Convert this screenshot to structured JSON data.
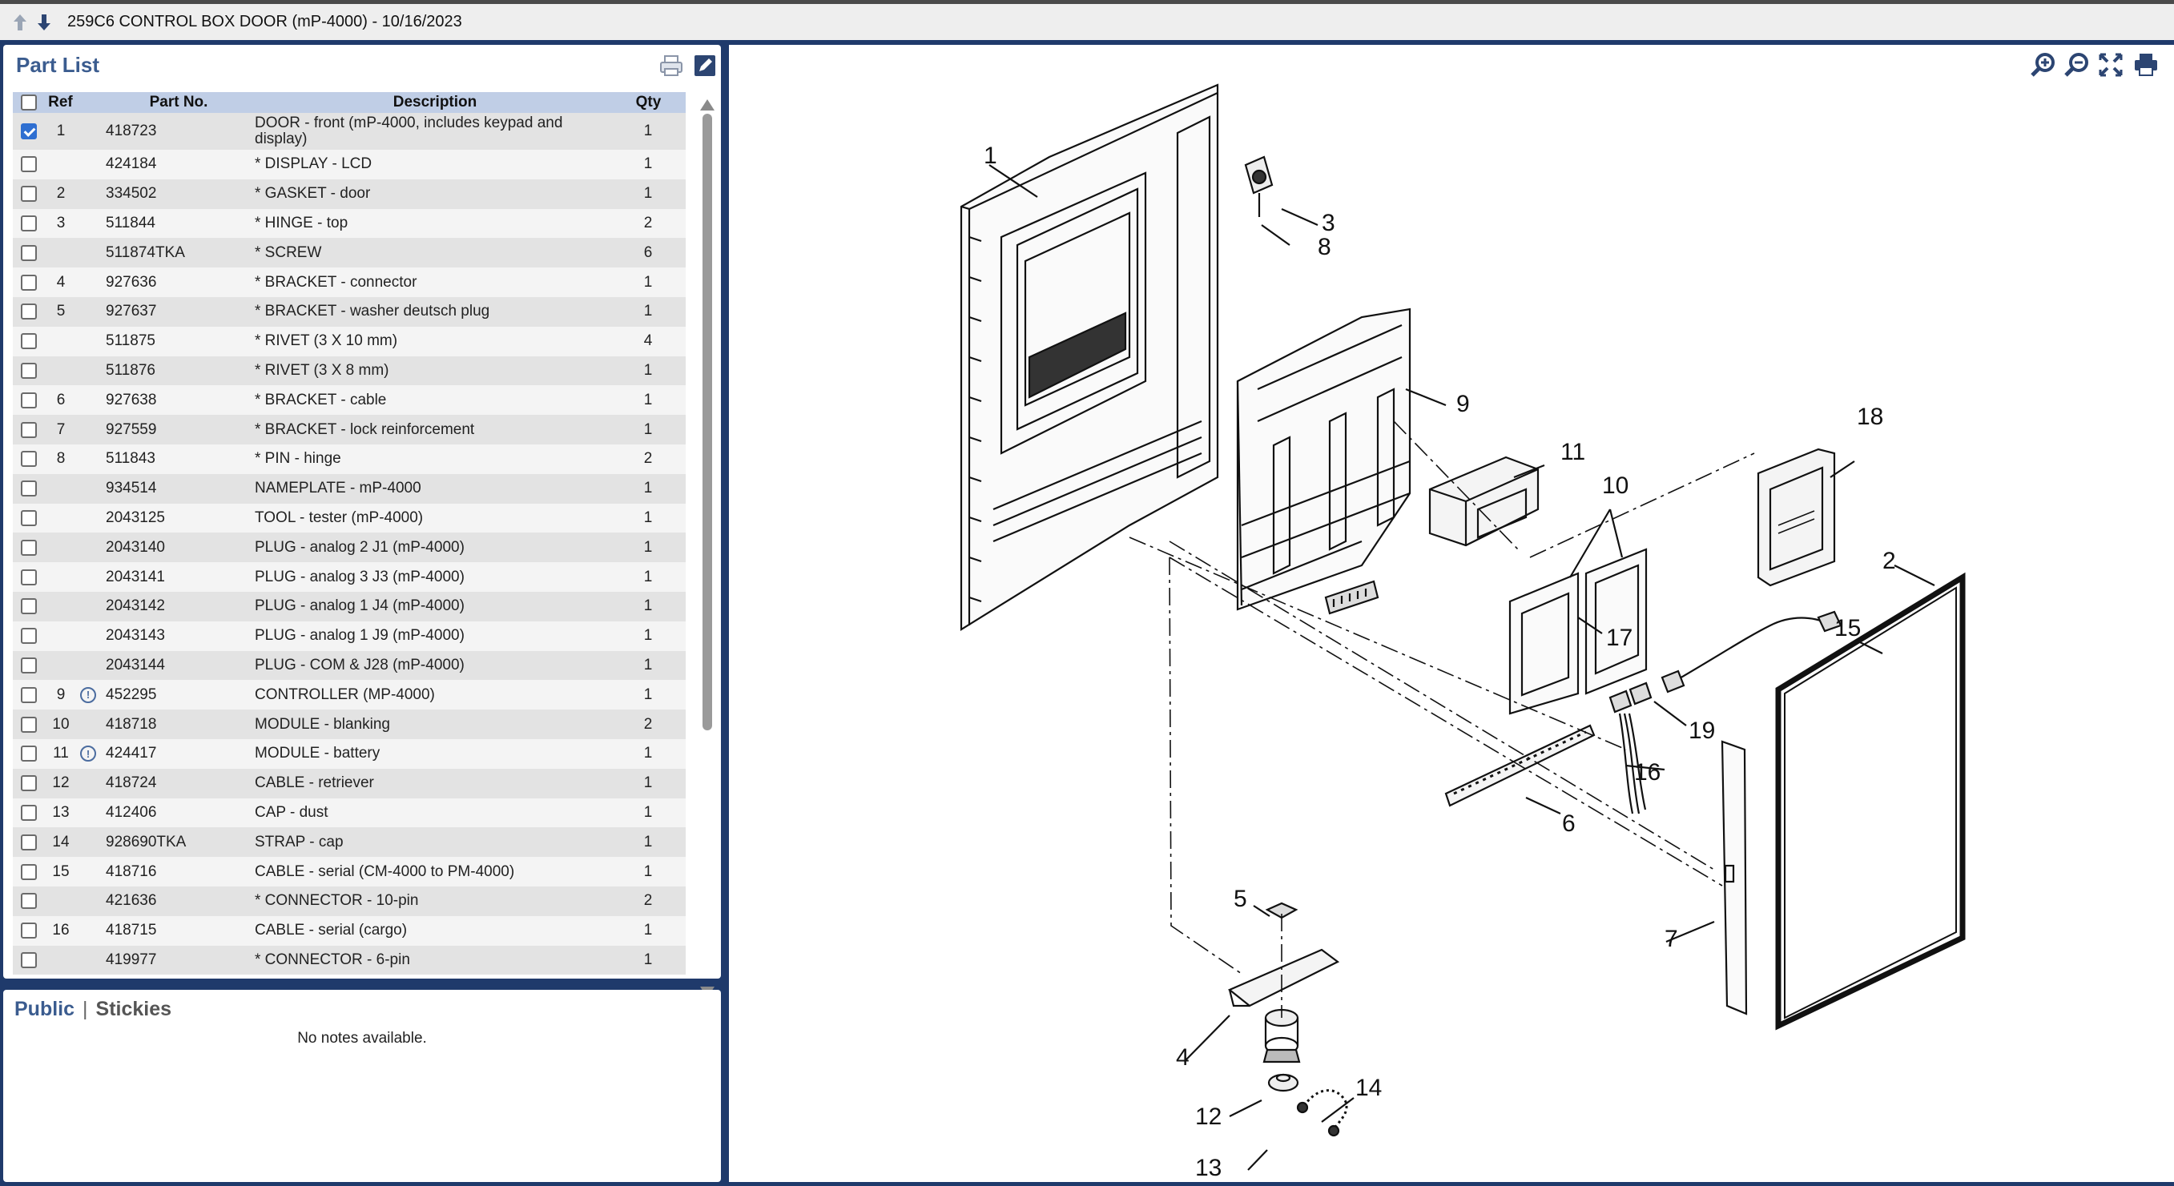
{
  "header": {
    "title": "259C6 CONTROL BOX DOOR (mP-4000) - 10/16/2023"
  },
  "part_list": {
    "title": "Part List",
    "columns": {
      "ref": "Ref",
      "part_no": "Part No.",
      "description": "Description",
      "qty": "Qty"
    },
    "rows": [
      {
        "checked": true,
        "ref": "1",
        "flag": "",
        "part": "418723",
        "desc": "DOOR - front (mP-4000, includes keypad and display)",
        "qty": "1"
      },
      {
        "checked": false,
        "ref": "",
        "flag": "",
        "part": "424184",
        "desc": "* DISPLAY - LCD",
        "qty": "1"
      },
      {
        "checked": false,
        "ref": "2",
        "flag": "",
        "part": "334502",
        "desc": "* GASKET - door",
        "qty": "1"
      },
      {
        "checked": false,
        "ref": "3",
        "flag": "",
        "part": "511844",
        "desc": "* HINGE - top",
        "qty": "2"
      },
      {
        "checked": false,
        "ref": "",
        "flag": "",
        "part": "511874TKA",
        "desc": "* SCREW",
        "qty": "6"
      },
      {
        "checked": false,
        "ref": "4",
        "flag": "",
        "part": "927636",
        "desc": "* BRACKET - connector",
        "qty": "1"
      },
      {
        "checked": false,
        "ref": "5",
        "flag": "",
        "part": "927637",
        "desc": "* BRACKET - washer deutsch plug",
        "qty": "1"
      },
      {
        "checked": false,
        "ref": "",
        "flag": "",
        "part": "511875",
        "desc": "* RIVET (3 X 10 mm)",
        "qty": "4"
      },
      {
        "checked": false,
        "ref": "",
        "flag": "",
        "part": "511876",
        "desc": "* RIVET (3 X 8 mm)",
        "qty": "1"
      },
      {
        "checked": false,
        "ref": "6",
        "flag": "",
        "part": "927638",
        "desc": "* BRACKET - cable",
        "qty": "1"
      },
      {
        "checked": false,
        "ref": "7",
        "flag": "",
        "part": "927559",
        "desc": "* BRACKET - lock reinforcement",
        "qty": "1"
      },
      {
        "checked": false,
        "ref": "8",
        "flag": "",
        "part": "511843",
        "desc": "* PIN - hinge",
        "qty": "2"
      },
      {
        "checked": false,
        "ref": "",
        "flag": "",
        "part": "934514",
        "desc": "NAMEPLATE - mP-4000",
        "qty": "1"
      },
      {
        "checked": false,
        "ref": "",
        "flag": "",
        "part": "2043125",
        "desc": "TOOL - tester (mP-4000)",
        "qty": "1"
      },
      {
        "checked": false,
        "ref": "",
        "flag": "",
        "part": "2043140",
        "desc": "PLUG - analog 2 J1 (mP-4000)",
        "qty": "1"
      },
      {
        "checked": false,
        "ref": "",
        "flag": "",
        "part": "2043141",
        "desc": "PLUG - analog 3 J3 (mP-4000)",
        "qty": "1"
      },
      {
        "checked": false,
        "ref": "",
        "flag": "",
        "part": "2043142",
        "desc": "PLUG - analog 1 J4 (mP-4000)",
        "qty": "1"
      },
      {
        "checked": false,
        "ref": "",
        "flag": "",
        "part": "2043143",
        "desc": "PLUG - analog 1 J9 (mP-4000)",
        "qty": "1"
      },
      {
        "checked": false,
        "ref": "",
        "flag": "",
        "part": "2043144",
        "desc": "PLUG - COM & J28 (mP-4000)",
        "qty": "1"
      },
      {
        "checked": false,
        "ref": "9",
        "flag": "!",
        "part": "452295",
        "desc": "CONTROLLER (MP-4000)",
        "qty": "1"
      },
      {
        "checked": false,
        "ref": "10",
        "flag": "",
        "part": "418718",
        "desc": "MODULE - blanking",
        "qty": "2"
      },
      {
        "checked": false,
        "ref": "11",
        "flag": "!",
        "part": "424417",
        "desc": "MODULE - battery",
        "qty": "1"
      },
      {
        "checked": false,
        "ref": "12",
        "flag": "",
        "part": "418724",
        "desc": "CABLE - retriever",
        "qty": "1"
      },
      {
        "checked": false,
        "ref": "13",
        "flag": "",
        "part": "412406",
        "desc": "CAP - dust",
        "qty": "1"
      },
      {
        "checked": false,
        "ref": "14",
        "flag": "",
        "part": "928690TKA",
        "desc": "STRAP - cap",
        "qty": "1"
      },
      {
        "checked": false,
        "ref": "15",
        "flag": "",
        "part": "418716",
        "desc": "CABLE - serial (CM-4000 to PM-4000)",
        "qty": "1"
      },
      {
        "checked": false,
        "ref": "",
        "flag": "",
        "part": "421636",
        "desc": "* CONNECTOR - 10-pin",
        "qty": "2"
      },
      {
        "checked": false,
        "ref": "16",
        "flag": "",
        "part": "418715",
        "desc": "CABLE - serial (cargo)",
        "qty": "1"
      },
      {
        "checked": false,
        "ref": "",
        "flag": "",
        "part": "419977",
        "desc": "* CONNECTOR - 6-pin",
        "qty": "1"
      }
    ]
  },
  "notes": {
    "tab_public": "Public",
    "separator": "|",
    "tab_stickies": "Stickies",
    "empty_text": "No notes available."
  },
  "diagram": {
    "callouts": [
      "1",
      "2",
      "3",
      "4",
      "5",
      "6",
      "7",
      "8",
      "9",
      "10",
      "11",
      "12",
      "13",
      "14",
      "15",
      "16",
      "17",
      "18",
      "19"
    ]
  }
}
